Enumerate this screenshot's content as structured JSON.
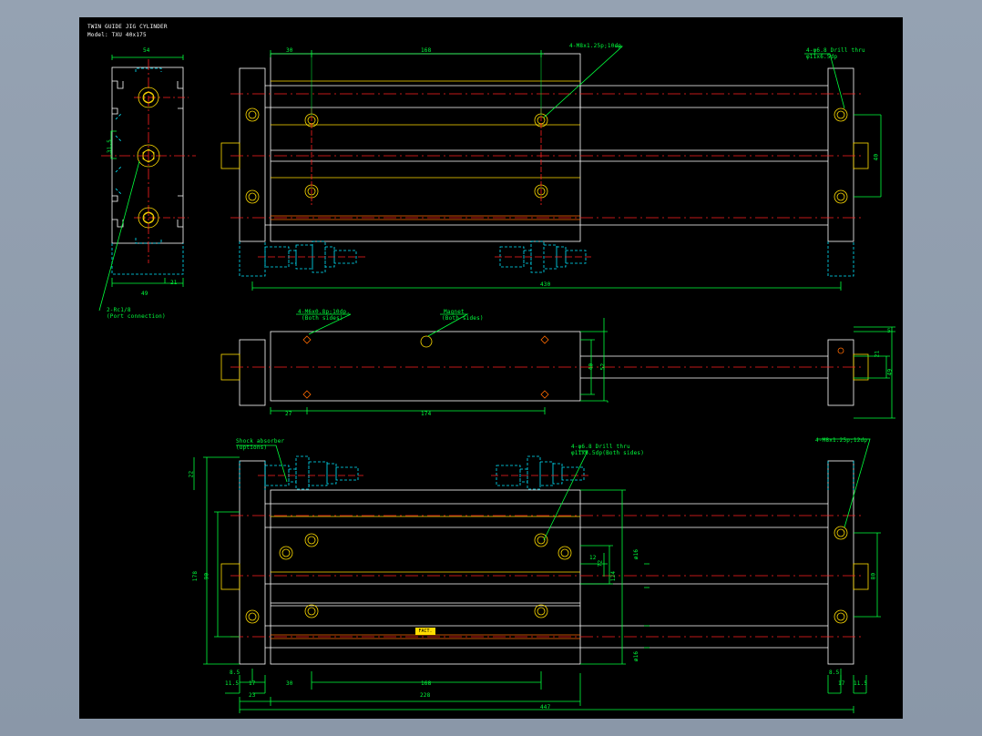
{
  "title_block": {
    "title": "TWIN GUIDE JIG CYLINDER",
    "model": "Model: TXU 40x175"
  },
  "notes": {
    "top_holes": "4-M8x1.25p;10dp",
    "end_holes": "4-φ6.8 Drill thru",
    "end_holes_cbore": "φ11x6.5dp",
    "port": "2-Rc1/8",
    "port_caption": "(Port connection)",
    "side_holes": "4-M6x0.8p;10dp.",
    "side_holes_caption": "(Both sides)",
    "magnet": "Magnet",
    "magnet_caption": "(Both sides)",
    "shock": "Shock absorber",
    "shock_caption": "(Options)",
    "bottom_thru": "4-φ6.8 Drill thru",
    "bottom_thru_cbore": "φ11x6.5dp(Both sides)",
    "bottom_right": "4-M8x1.25p;12dp"
  },
  "dims": {
    "d54": "54",
    "d30": "30",
    "d168": "168",
    "d430": "430",
    "d49": "49",
    "d21": "21",
    "d40": "40",
    "d31_5": "31.5",
    "d27": "27",
    "d174": "174",
    "d40b": "40",
    "d52": "52",
    "d5": "5",
    "d21b": "21",
    "d49b": "49",
    "d22": "22",
    "d178": "178",
    "d90": "90",
    "d72": "72",
    "d124": "124",
    "d16a": "ø16",
    "d16b": "ø16",
    "d12": "12",
    "d80": "80",
    "d8_5a": "8.5",
    "d8_5b": "8.5",
    "d11_5a": "11.5",
    "d17a": "17",
    "d30b": "30",
    "d168b": "168",
    "d17b": "17",
    "d11_5b": "11.5",
    "d23": "23",
    "d228": "228",
    "d447": "447"
  },
  "tag": "FACT."
}
